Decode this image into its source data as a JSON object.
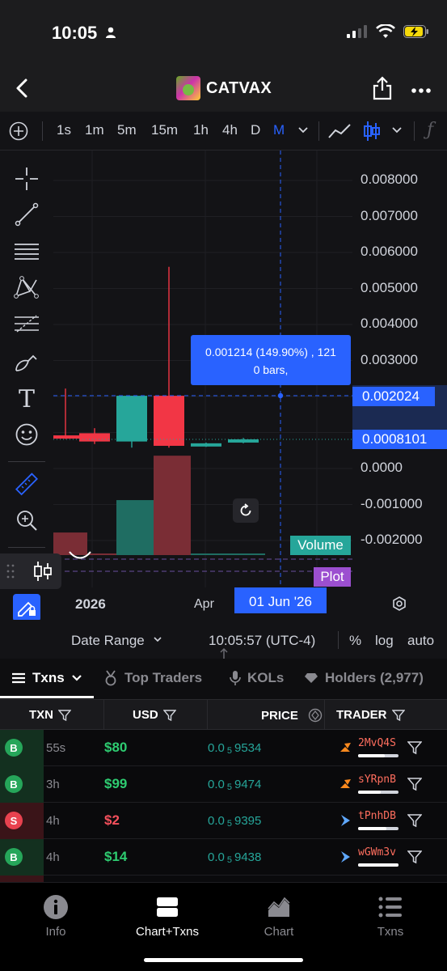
{
  "status": {
    "time": "10:05"
  },
  "header": {
    "token_name": "CATVAX"
  },
  "timeframes": {
    "items": [
      "1s",
      "1m",
      "5m",
      "15m",
      "1h",
      "4h",
      "D",
      "M"
    ],
    "active": "M",
    "chevron": "chevron-down-icon"
  },
  "chart": {
    "price_labels": [
      "0.008000",
      "0.007000",
      "0.006000",
      "0.005000",
      "0.004000",
      "0.003000",
      "0.0000",
      "-0.001000",
      "-0.002000"
    ],
    "current_price_tag": "0.0008101",
    "crosshair_price_tag": "0.002024",
    "measure_tooltip_line1": "0.001214 (149.90%) , 121",
    "measure_tooltip_line2": "0 bars,",
    "volume_label": "Volume",
    "plot_label": "Plot",
    "time_labels": {
      "year": "2026",
      "month": "Apr"
    },
    "crosshair_date": "01 Jun '26",
    "colors": {
      "up": "#26a69a",
      "down": "#f23645",
      "accent": "#2962ff",
      "volume_tag": "#26a69a",
      "plot_tag": "#9c4fd0"
    }
  },
  "chart_data": {
    "type": "candlestick",
    "candles": [
      {
        "open": 0.00092,
        "high": 0.00222,
        "low": 0.00082,
        "close": 0.00092,
        "dir": "down"
      },
      {
        "open": 0.00098,
        "high": 0.00112,
        "low": 0.00068,
        "close": 0.00075,
        "dir": "down"
      },
      {
        "open": 0.00075,
        "high": 0.00202,
        "low": 0.00058,
        "close": 0.00202,
        "dir": "up"
      },
      {
        "open": 0.00202,
        "high": 0.0056,
        "low": 0.00058,
        "close": 0.00063,
        "dir": "down"
      },
      {
        "open": 0.00063,
        "high": 0.00072,
        "low": 0.0006,
        "close": 0.0007,
        "dir": "up"
      },
      {
        "open": 0.00072,
        "high": 0.00085,
        "low": 0.0007,
        "close": 0.00081,
        "dir": "up"
      }
    ],
    "volumes": [
      {
        "value": 0.62,
        "dir": "down"
      },
      {
        "value": 0.03,
        "dir": "down"
      },
      {
        "value": 1.51,
        "dir": "up"
      },
      {
        "value": 2.73,
        "dir": "down"
      },
      {
        "value": 0.02,
        "dir": "up"
      },
      {
        "value": 0.02,
        "dir": "up"
      }
    ],
    "ylim": [
      -0.0022,
      0.0086
    ]
  },
  "chart_footer": {
    "date_range": "Date Range",
    "clock": "10:05:57 (UTC-4)",
    "percent": "%",
    "log": "log",
    "auto": "auto"
  },
  "tabs": [
    {
      "label": "Txns",
      "icon": "list-icon"
    },
    {
      "label": "Top Traders",
      "icon": "medal-icon"
    },
    {
      "label": "KOLs",
      "icon": "microphone-icon"
    },
    {
      "label": "Holders (2,977)",
      "icon": "diamond-icon"
    }
  ],
  "table": {
    "headers": [
      "TXN",
      "USD",
      "PRICE",
      "TRADER"
    ],
    "rows": [
      {
        "side": "B",
        "age": "55s",
        "usd": "$80",
        "price_prefix": "0.0",
        "price_zeros": "5",
        "price_digits": "9534",
        "trader": "2MvQ4S",
        "trader_color": "#ff6e5e",
        "icon": "pump-icon",
        "bar": 0.65
      },
      {
        "side": "B",
        "age": "3h",
        "usd": "$99",
        "price_prefix": "0.0",
        "price_zeros": "5",
        "price_digits": "9474",
        "trader": "sYRpnB",
        "trader_color": "#ff6e5e",
        "icon": "pump-icon",
        "bar": 0.55
      },
      {
        "side": "S",
        "age": "4h",
        "usd": "$2",
        "price_prefix": "0.0",
        "price_zeros": "5",
        "price_digits": "9395",
        "trader": "tPnhDB",
        "trader_color": "#ff6e5e",
        "icon": "bird-icon",
        "bar": 0.7
      },
      {
        "side": "B",
        "age": "4h",
        "usd": "$14",
        "price_prefix": "0.0",
        "price_zeros": "5",
        "price_digits": "9438",
        "trader": "wGWm3v",
        "trader_color": "#ff6e5e",
        "icon": "bird-icon",
        "bar": 1.0
      }
    ]
  },
  "bottom_nav": [
    {
      "label": "Info",
      "icon": "info-icon"
    },
    {
      "label": "Chart+Txns",
      "icon": "split-view-icon"
    },
    {
      "label": "Chart",
      "icon": "area-chart-icon"
    },
    {
      "label": "Txns",
      "icon": "list-icon"
    }
  ]
}
